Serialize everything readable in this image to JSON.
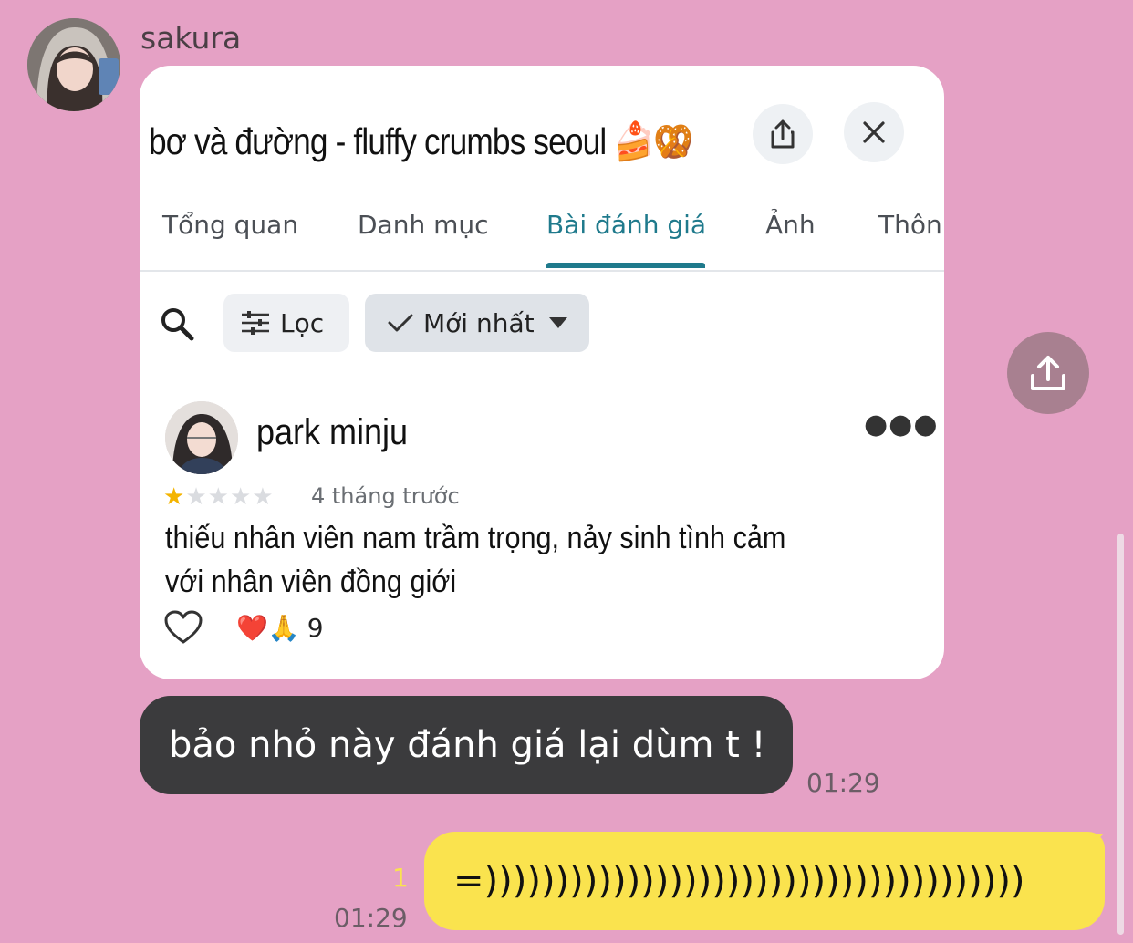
{
  "sender": {
    "name": "sakura"
  },
  "shared_image": {
    "place_title": "bơ và đường - fluffy crumbs seoul 🍰🥨",
    "tabs": [
      {
        "label": "Tổng quan"
      },
      {
        "label": "Danh mục"
      },
      {
        "label": "Bài đánh giá"
      },
      {
        "label": "Ảnh"
      },
      {
        "label": "Thôn"
      }
    ],
    "active_tab": "Bài đánh giá",
    "filters": {
      "filter_label": "Lọc",
      "sort_label": "Mới nhất"
    },
    "review": {
      "reviewer": "park minju",
      "rating": 1,
      "rating_max": 5,
      "time": "4 tháng trước",
      "text": "thiếu nhân viên nam trầm trọng, nảy sinh tình cảm với nhân viên đồng giới",
      "reactions": "❤️🙏",
      "reaction_count": "9"
    }
  },
  "messages": [
    {
      "direction": "incoming",
      "text": "bảo nhỏ này đánh giá lại dùm t !",
      "time": "01:29"
    },
    {
      "direction": "outgoing",
      "text": "=))))))))))))))))))))))))))))))))))))))",
      "time": "01:29",
      "unread": "1"
    }
  ],
  "colors": {
    "background": "#e5a1c5",
    "incoming_bubble": "#3b3b3d",
    "outgoing_bubble": "#fae34e",
    "tab_accent": "#1f7a8c"
  }
}
